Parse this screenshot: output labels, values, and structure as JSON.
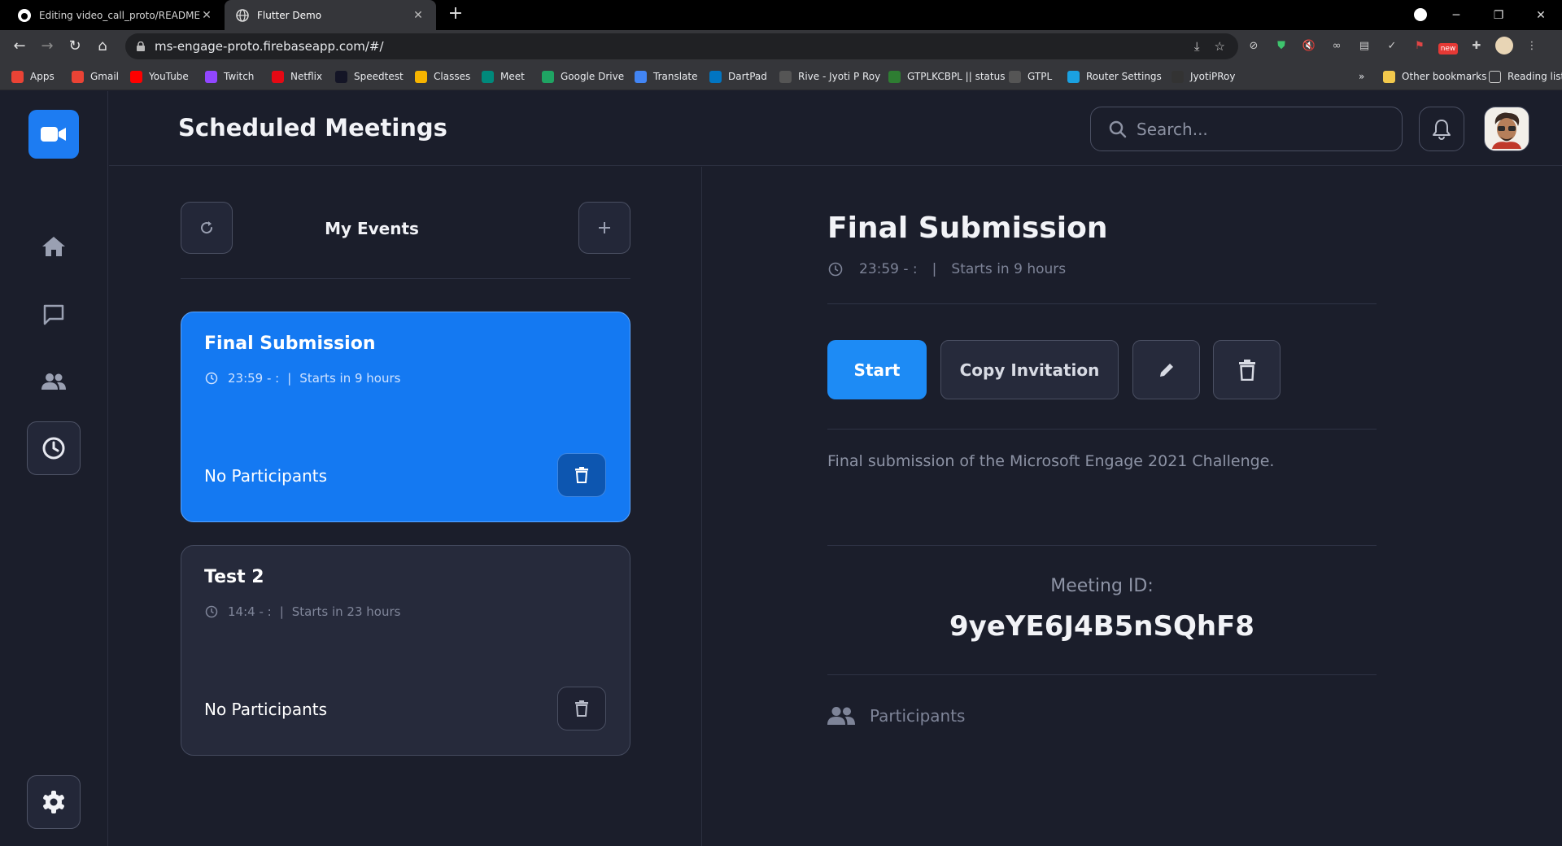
{
  "browser": {
    "tabs": [
      {
        "title": "Editing video_call_proto/README.md",
        "active": false
      },
      {
        "title": "Flutter Demo",
        "active": true
      }
    ],
    "new_tab": "+",
    "url": "ms-engage-proto.firebaseapp.com/#/",
    "bookmarks": [
      {
        "label": "Apps",
        "icon": "apps-grid-icon",
        "color": "#ea4335"
      },
      {
        "label": "Gmail",
        "icon": "gmail-icon",
        "color": "#ea4335"
      },
      {
        "label": "YouTube",
        "icon": "youtube-icon",
        "color": "#ff0000"
      },
      {
        "label": "Twitch",
        "icon": "twitch-icon",
        "color": "#9146ff"
      },
      {
        "label": "Netflix",
        "icon": "netflix-icon",
        "color": "#e50914"
      },
      {
        "label": "Speedtest",
        "icon": "speedtest-icon",
        "color": "#141526"
      },
      {
        "label": "Classes",
        "icon": "classroom-icon",
        "color": "#f6b400"
      },
      {
        "label": "Meet",
        "icon": "meet-icon",
        "color": "#00897b"
      },
      {
        "label": "Google Drive",
        "icon": "drive-icon",
        "color": "#1fa463"
      },
      {
        "label": "Translate",
        "icon": "translate-icon",
        "color": "#4285f4"
      },
      {
        "label": "DartPad",
        "icon": "dartpad-icon",
        "color": "#0175c2"
      },
      {
        "label": "Rive - Jyoti P Roy",
        "icon": "rive-icon",
        "color": "#555555"
      },
      {
        "label": "GTPLKCBPL || status",
        "icon": "gtpl-status-icon",
        "color": "#2e7d32"
      },
      {
        "label": "GTPL",
        "icon": "gtpl-icon",
        "color": "#555555"
      },
      {
        "label": "Router Settings",
        "icon": "router-icon",
        "color": "#1aa1e1"
      },
      {
        "label": "JyotiPRoy",
        "icon": "github-icon",
        "color": "#333333"
      }
    ],
    "overflow": "»",
    "other_bookmarks": "Other bookmarks",
    "reading_list": "Reading list",
    "ext_badge": "new"
  },
  "header": {
    "title": "Scheduled Meetings",
    "search_placeholder": "Search..."
  },
  "events": {
    "title": "My Events",
    "items": [
      {
        "title": "Final Submission",
        "time": "23:59 - :",
        "sep": "|",
        "starts": "Starts in 9 hours",
        "participants": "No Participants",
        "selected": true
      },
      {
        "title": "Test 2",
        "time": "14:4 - :",
        "sep": "|",
        "starts": "Starts in 23 hours",
        "participants": "No Participants",
        "selected": false
      }
    ]
  },
  "detail": {
    "title": "Final Submission",
    "time": "23:59 - :",
    "sep": "|",
    "starts": "Starts in 9 hours",
    "start_label": "Start",
    "copy_label": "Copy Invitation",
    "description": "Final submission of the Microsoft Engage 2021 Challenge.",
    "meeting_id_label": "Meeting ID:",
    "meeting_id": "9yeYE6J4B5nSQhF8",
    "participants_label": "Participants"
  },
  "colors": {
    "background": "#1b1e2b",
    "accent": "#1479f2",
    "card": "#262a3b",
    "border": "#4a4f62"
  }
}
